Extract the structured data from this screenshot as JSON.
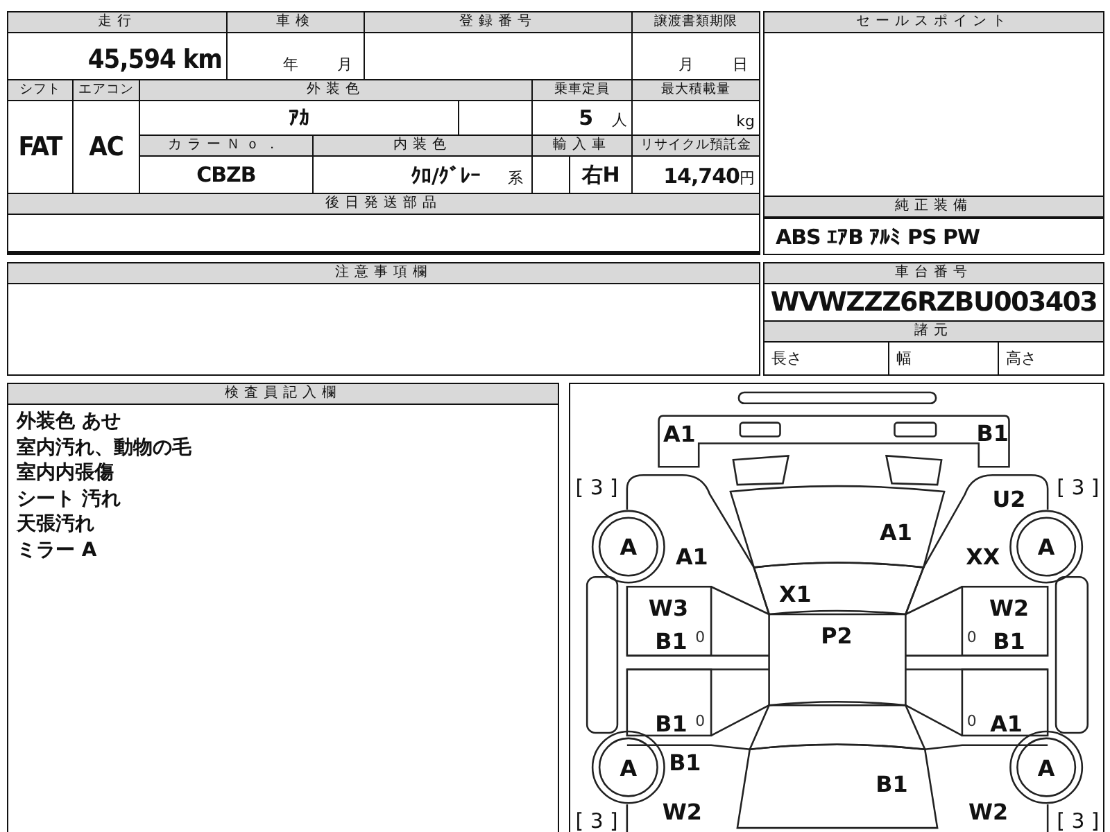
{
  "mileage": {
    "label": "走行",
    "value": "45,594",
    "unit": "km"
  },
  "inspection": {
    "label": "車検",
    "year_unit": "年",
    "month_unit": "月"
  },
  "registration_number": {
    "label": "登録番号"
  },
  "transfer_deadline": {
    "label": "譲渡書類期限",
    "month_unit": "月",
    "day_unit": "日"
  },
  "shift": {
    "label": "シフト",
    "value": "FAT"
  },
  "aircon": {
    "label": "エアコン",
    "value": "AC"
  },
  "exterior_color": {
    "label": "外装色",
    "value": "ｱｶ"
  },
  "capacity": {
    "label": "乗車定員",
    "value": "5",
    "unit": "人"
  },
  "max_load": {
    "label": "最大積載量",
    "unit": "kg"
  },
  "color_no": {
    "label": "カラーＮｏ．",
    "value": "CBZB"
  },
  "interior_color": {
    "label": "内装色",
    "value": "ｸﾛ/ｸﾞﾚｰ",
    "suffix": "系"
  },
  "import": {
    "label": "輸入車",
    "value": "右H"
  },
  "recycle_fee": {
    "label": "リサイクル預託金",
    "value": "14,740",
    "unit": "円"
  },
  "later_parts": {
    "label": "後日発送部品"
  },
  "sales_points": {
    "label": "セールスポイント"
  },
  "genuine_equipment": {
    "label": "純正装備",
    "value": "ABS ｴｱB ｱﾙﾐ PS PW"
  },
  "chassis_number": {
    "label": "車台番号",
    "value": "WVWZZZ6RZBU003403"
  },
  "specs": {
    "label": "諸元",
    "items": [
      "長さ",
      "幅",
      "高さ"
    ]
  },
  "notes": {
    "label": "注意事項欄"
  },
  "inspector_comments": {
    "label": "検査員記入欄",
    "lines": [
      "外装色 あせ",
      "室内汚れ、動物の毛",
      "室内内張傷",
      "シート 汚れ",
      "天張汚れ",
      "ミラー A"
    ]
  },
  "diagram": {
    "damage_codes": [
      "A1",
      "B1",
      "U2",
      "A1",
      "A1",
      "XX",
      "X1",
      "W3",
      "W2",
      "B1",
      "P2",
      "B1",
      "B1",
      "A1",
      "B1",
      "B1",
      "W2",
      "W2"
    ],
    "tire_grades": [
      "A",
      "A",
      "A",
      "A"
    ],
    "tread_ratings": [
      "[ 3 ]",
      "[ 3 ]",
      "[ 3 ]",
      "[ 3 ]"
    ],
    "door_marks": [
      "0",
      "0",
      "0",
      "0"
    ]
  }
}
